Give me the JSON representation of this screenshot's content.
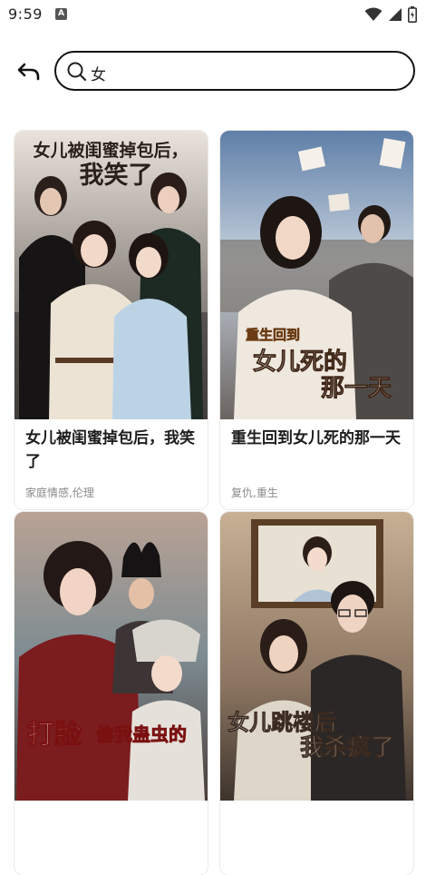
{
  "status_bar": {
    "time": "9:59",
    "notification_letter": "A"
  },
  "search": {
    "query": "女"
  },
  "results": [
    {
      "title": "女儿被闺蜜掉包后，我笑了",
      "tags": "家庭情感,伦理",
      "poster_text": [
        "女儿被闺蜜掉包后，",
        "我笑了"
      ]
    },
    {
      "title": "重生回到女儿死的那一天",
      "tags": "复仇,重生",
      "poster_text": [
        "重生回到",
        "女儿死的",
        "那一天"
      ]
    },
    {
      "title": "",
      "tags": "",
      "poster_text": [
        "打脸",
        "偷我蛊虫的"
      ]
    },
    {
      "title": "",
      "tags": "",
      "poster_text": [
        "女儿跳楼后",
        "我杀疯了"
      ]
    }
  ],
  "colors": {
    "search_border": "#111111",
    "title": "#1d1d1d",
    "tags": "#8a8a8a"
  }
}
